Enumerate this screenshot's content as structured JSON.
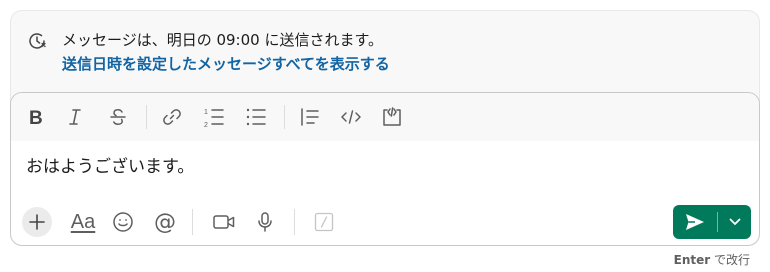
{
  "schedule": {
    "icon": "scheduled-clock-icon",
    "message": "メッセージは、明日の 09:00 に送信されます。",
    "link": "送信日時を設定したメッセージすべてを表示する"
  },
  "toolbar": {
    "items": [
      "bold-icon",
      "italic-icon",
      "strikethrough-icon",
      "link-icon",
      "numbered-list-icon",
      "bulleted-list-icon",
      "blockquote-icon",
      "code-icon",
      "code-block-icon"
    ]
  },
  "message": {
    "value": "おはようございます。"
  },
  "bottom_toolbar": {
    "formatting_label": "Aa",
    "mention_label": "@",
    "items": [
      "plus-icon",
      "formatting-icon",
      "emoji-icon",
      "mention-icon",
      "video-icon",
      "microphone-icon",
      "slash-command-icon"
    ]
  },
  "send": {
    "icon": "paper-plane-icon",
    "options_icon": "chevron-down-icon",
    "accent": "#007a5a"
  },
  "hint": {
    "key": "Enter",
    "text": " で改行"
  },
  "colors": {
    "link": "#1264a3",
    "banner_bg": "#f8f8f8",
    "icon": "#5e5e5e"
  }
}
